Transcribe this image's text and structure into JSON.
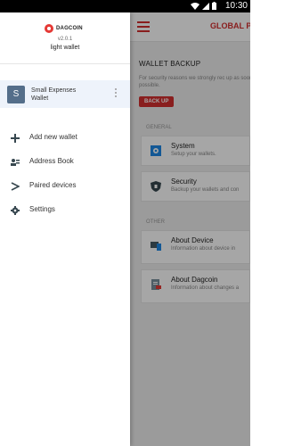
{
  "status_bar": {
    "time": "10:30"
  },
  "drawer": {
    "brand": "DAGCOIN",
    "version": "v2.0.1",
    "wallet_type": "light wallet",
    "wallet": {
      "avatar_letter": "S",
      "name": "Small Expenses Wallet"
    },
    "nav": [
      {
        "label": "Add new wallet",
        "icon": "plus-icon"
      },
      {
        "label": "Address Book",
        "icon": "contacts-icon"
      },
      {
        "label": "Paired devices",
        "icon": "paired-devices-icon"
      },
      {
        "label": "Settings",
        "icon": "gear-icon"
      }
    ]
  },
  "main": {
    "title": "GLOBAL P",
    "backup": {
      "title": "WALLET BACKUP",
      "desc": "For security reasons we strongly rec up as soon as possible.",
      "button": "BACK UP"
    },
    "general_label": "GENERAL",
    "general": [
      {
        "title": "System",
        "subtitle": "Setup your wallets.",
        "icon": "system-gear-icon"
      },
      {
        "title": "Security",
        "subtitle": "Backup your wallets and con",
        "icon": "security-shield-icon"
      }
    ],
    "other_label": "OTHER",
    "other": [
      {
        "title": "About Device",
        "subtitle": "Information about device in",
        "icon": "device-icon"
      },
      {
        "title": "About Dagcoin",
        "subtitle": "Information about changes a",
        "icon": "document-icon"
      }
    ]
  },
  "colors": {
    "accent": "#d32f2f",
    "wallet_highlight": "#eef3fb",
    "avatar": "#546e8a"
  }
}
